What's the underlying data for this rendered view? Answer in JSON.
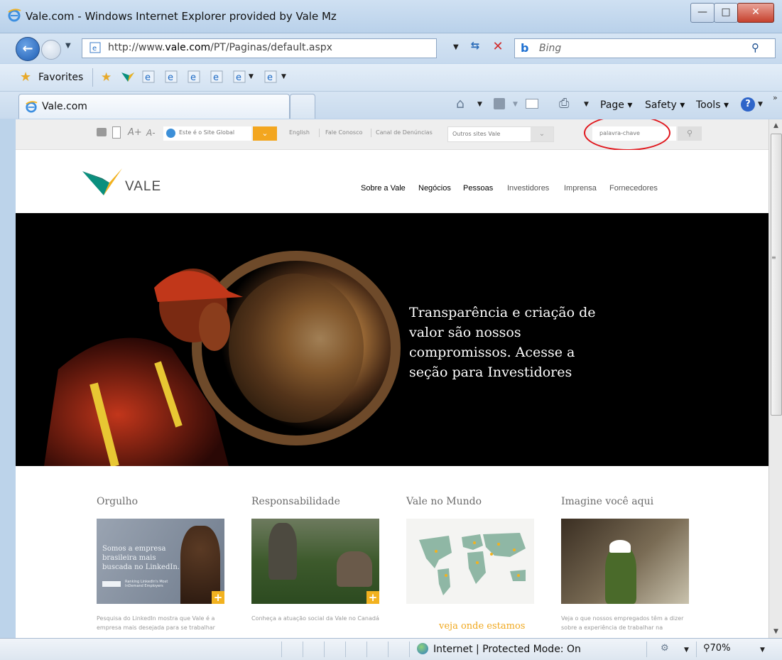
{
  "window": {
    "title": "Vale.com - Windows Internet Explorer provided by Vale Mz",
    "minimize": "—",
    "maximize": "□",
    "close": "✕"
  },
  "address": {
    "url_prefix": "http://www.",
    "url_domain": "vale.com",
    "url_path": "/PT/Paginas/default.aspx",
    "search_placeholder": "Bing"
  },
  "favorites": {
    "label": "Favorites"
  },
  "tab": {
    "label": "Vale.com"
  },
  "commands": {
    "page": "Page",
    "safety": "Safety",
    "tools": "Tools"
  },
  "util": {
    "site_select": "Este é o Site Global",
    "english": "English",
    "fale": "Fale Conosco",
    "canal": "Canal de Denúncias",
    "outros": "Outros sites Vale",
    "search_placeholder": "palavra-chave",
    "aplus": "A+",
    "aminus": "A-"
  },
  "header": {
    "logo_text": "VALE",
    "nav": [
      "Sobre a Vale",
      "Negócios",
      "Pessoas",
      "Investidores",
      "Imprensa",
      "Fornecedores"
    ]
  },
  "hero": {
    "text": "Transparência e criação de valor são nossos compromissos. Acesse a seção para Investidores"
  },
  "cards": [
    {
      "title": "Orgulho",
      "img_text": "Somos a empresa brasileira mais buscada no LinkedIn.",
      "img_sub": "Ranking LinkedIn's Most InDemand Employers",
      "desc": "Pesquisa do LinkedIn mostra que Vale é a empresa mais desejada para se trabalhar"
    },
    {
      "title": "Responsabilidade",
      "desc": "Conheça a atuação social da Vale no Canadá"
    },
    {
      "title": "Vale no Mundo",
      "link": "veja onde estamos"
    },
    {
      "title": "Imagine você aqui",
      "desc": "Veja o que nossos empregados têm a dizer sobre a experiência de trabalhar na"
    }
  ],
  "status": {
    "zone": "Internet | Protected Mode: On",
    "zoom": "70%"
  },
  "colors": {
    "accent_orange": "#f3a61f",
    "vale_green": "#0a8f7e",
    "vale_yellow": "#f2b21f",
    "highlight_red": "#e0151b"
  }
}
